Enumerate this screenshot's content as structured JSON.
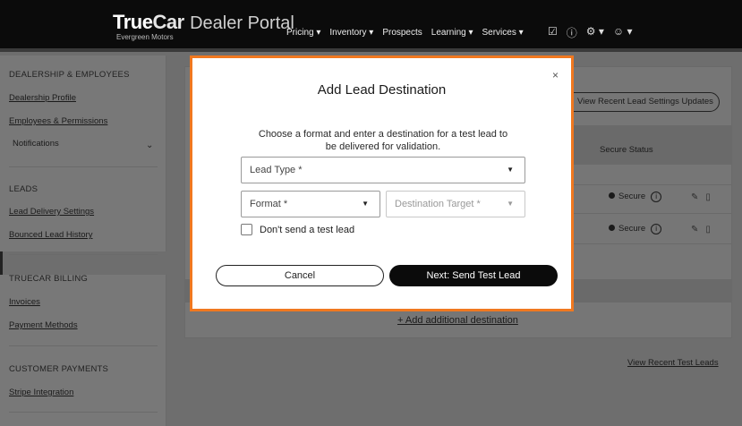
{
  "header": {
    "brand_true": "True",
    "brand_car": "Car",
    "brand_portal": "Dealer Portal",
    "dealer_name": "Evergreen Motors",
    "nav": [
      "Pricing ▾",
      "Inventory ▾",
      "Prospects",
      "Learning ▾",
      "Services ▾"
    ],
    "icons": [
      "clipboard-check-icon",
      "help-circle-icon",
      "gear-icon",
      "user-icon"
    ]
  },
  "sidebar": {
    "sections": [
      {
        "heading": "DEALERSHIP & EMPLOYEES",
        "items": [
          "Dealership Profile",
          "Employees & Permissions",
          "Notifications"
        ]
      },
      {
        "heading": "LEADS",
        "items": [
          "Lead Delivery Settings",
          "Bounced Lead History"
        ]
      },
      {
        "heading": "TRUECAR BILLING",
        "items": [
          "Invoices",
          "Payment Methods"
        ]
      },
      {
        "heading": "CUSTOMER PAYMENTS",
        "items": [
          "Stripe Integration"
        ]
      }
    ]
  },
  "main": {
    "recent_settings_btn": "View Recent Lead Settings Updates",
    "col_secure_status": "Secure Status",
    "rows": [
      {
        "status": "Secure"
      },
      {
        "status": "Secure"
      }
    ],
    "add_destination": "+ Add additional destination",
    "view_recent_test_leads": "View Recent Test Leads"
  },
  "modal": {
    "close": "×",
    "title": "Add Lead Destination",
    "description": "Choose a format and enter a destination for a test lead to be delivered for validation.",
    "lead_type_placeholder": "Lead Type *",
    "format_placeholder": "Format *",
    "destination_placeholder": "Destination Target *",
    "checkbox_label": "Don't send a test lead",
    "cancel_label": "Cancel",
    "next_label": "Next: Send Test Lead",
    "accent_color": "#f07820"
  }
}
